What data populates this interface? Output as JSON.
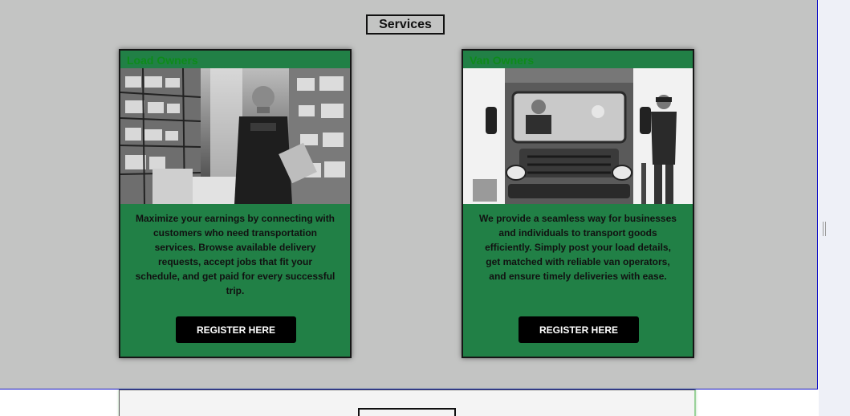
{
  "services": {
    "title": "Services"
  },
  "cards": [
    {
      "title": "Load Owners",
      "image_desc": "warehouse-worker-photo",
      "description": "Maximize your earnings by connecting with customers who need transportation services. Browse available delivery requests, accept jobs that fit your schedule, and get paid for every successful trip.",
      "button_label": "REGISTER HERE"
    },
    {
      "title": "Van Owners",
      "image_desc": "van-drivers-photo",
      "description": "We provide a seamless way for businesses and individuals to transport goods efficiently. Simply post your load details, get matched with reliable van operators, and ensure timely deliveries with ease.",
      "button_label": "REGISTER HERE"
    }
  ],
  "colors": {
    "section_bg": "#c3c4c3",
    "card_bg": "#218046",
    "card_title": "#0d8a1a",
    "button_bg": "#000000",
    "button_text": "#ffffff",
    "border_accent": "#1212c8"
  }
}
